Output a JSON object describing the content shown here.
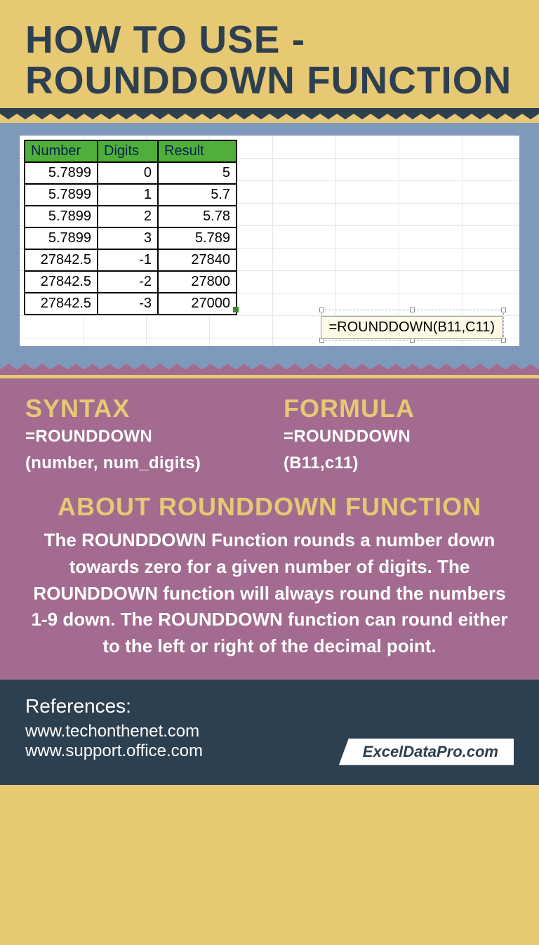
{
  "chart_data": {
    "type": "table",
    "title": "ROUNDDOWN Function Examples",
    "columns": [
      "Number",
      "Digits",
      "Result"
    ],
    "rows": [
      {
        "Number": 5.7899,
        "Digits": 0,
        "Result": 5
      },
      {
        "Number": 5.7899,
        "Digits": 1,
        "Result": 5.7
      },
      {
        "Number": 5.7899,
        "Digits": 2,
        "Result": 5.78
      },
      {
        "Number": 5.7899,
        "Digits": 3,
        "Result": 5.789
      },
      {
        "Number": 27842.5,
        "Digits": -1,
        "Result": 27840
      },
      {
        "Number": 27842.5,
        "Digits": -2,
        "Result": 27800
      },
      {
        "Number": 27842.5,
        "Digits": -3,
        "Result": 27000
      }
    ]
  },
  "header": {
    "title_line1": "HOW TO USE -",
    "title_line2": "ROUNDDOWN FUNCTION"
  },
  "table": {
    "headers": [
      "Number",
      "Digits",
      "Result"
    ],
    "rows": [
      [
        "5.7899",
        "0",
        "5"
      ],
      [
        "5.7899",
        "1",
        "5.7"
      ],
      [
        "5.7899",
        "2",
        "5.78"
      ],
      [
        "5.7899",
        "3",
        "5.789"
      ],
      [
        "27842.5",
        "-1",
        "27840"
      ],
      [
        "27842.5",
        "-2",
        "27800"
      ],
      [
        "27842.5",
        "-3",
        "27000"
      ]
    ],
    "tooltip": "=ROUNDDOWN(B11,C11)"
  },
  "syntax": {
    "heading": "SYNTAX",
    "line1": "=ROUNDDOWN",
    "line2": "(number, num_digits)"
  },
  "formula": {
    "heading": "FORMULA",
    "line1": "=ROUNDDOWN",
    "line2": "(B11,c11)"
  },
  "about": {
    "heading": "ABOUT ROUNDDOWN FUNCTION",
    "body": "The ROUNDDOWN Function rounds a number down towards zero for a given number of digits. The ROUNDDOWN function will always round the numbers 1-9 down. The ROUNDDOWN function can round either to the left or right of the decimal point."
  },
  "references": {
    "heading": "References:",
    "links": [
      "www.techonthenet.com",
      "www.support.office.com"
    ]
  },
  "watermark": "ExcelDataPro.com",
  "colors": {
    "yellow": "#e7c873",
    "darkblue": "#2d4050",
    "steelblue": "#7e99bb",
    "mauve": "#a26b8f",
    "green": "#4faf3a"
  }
}
